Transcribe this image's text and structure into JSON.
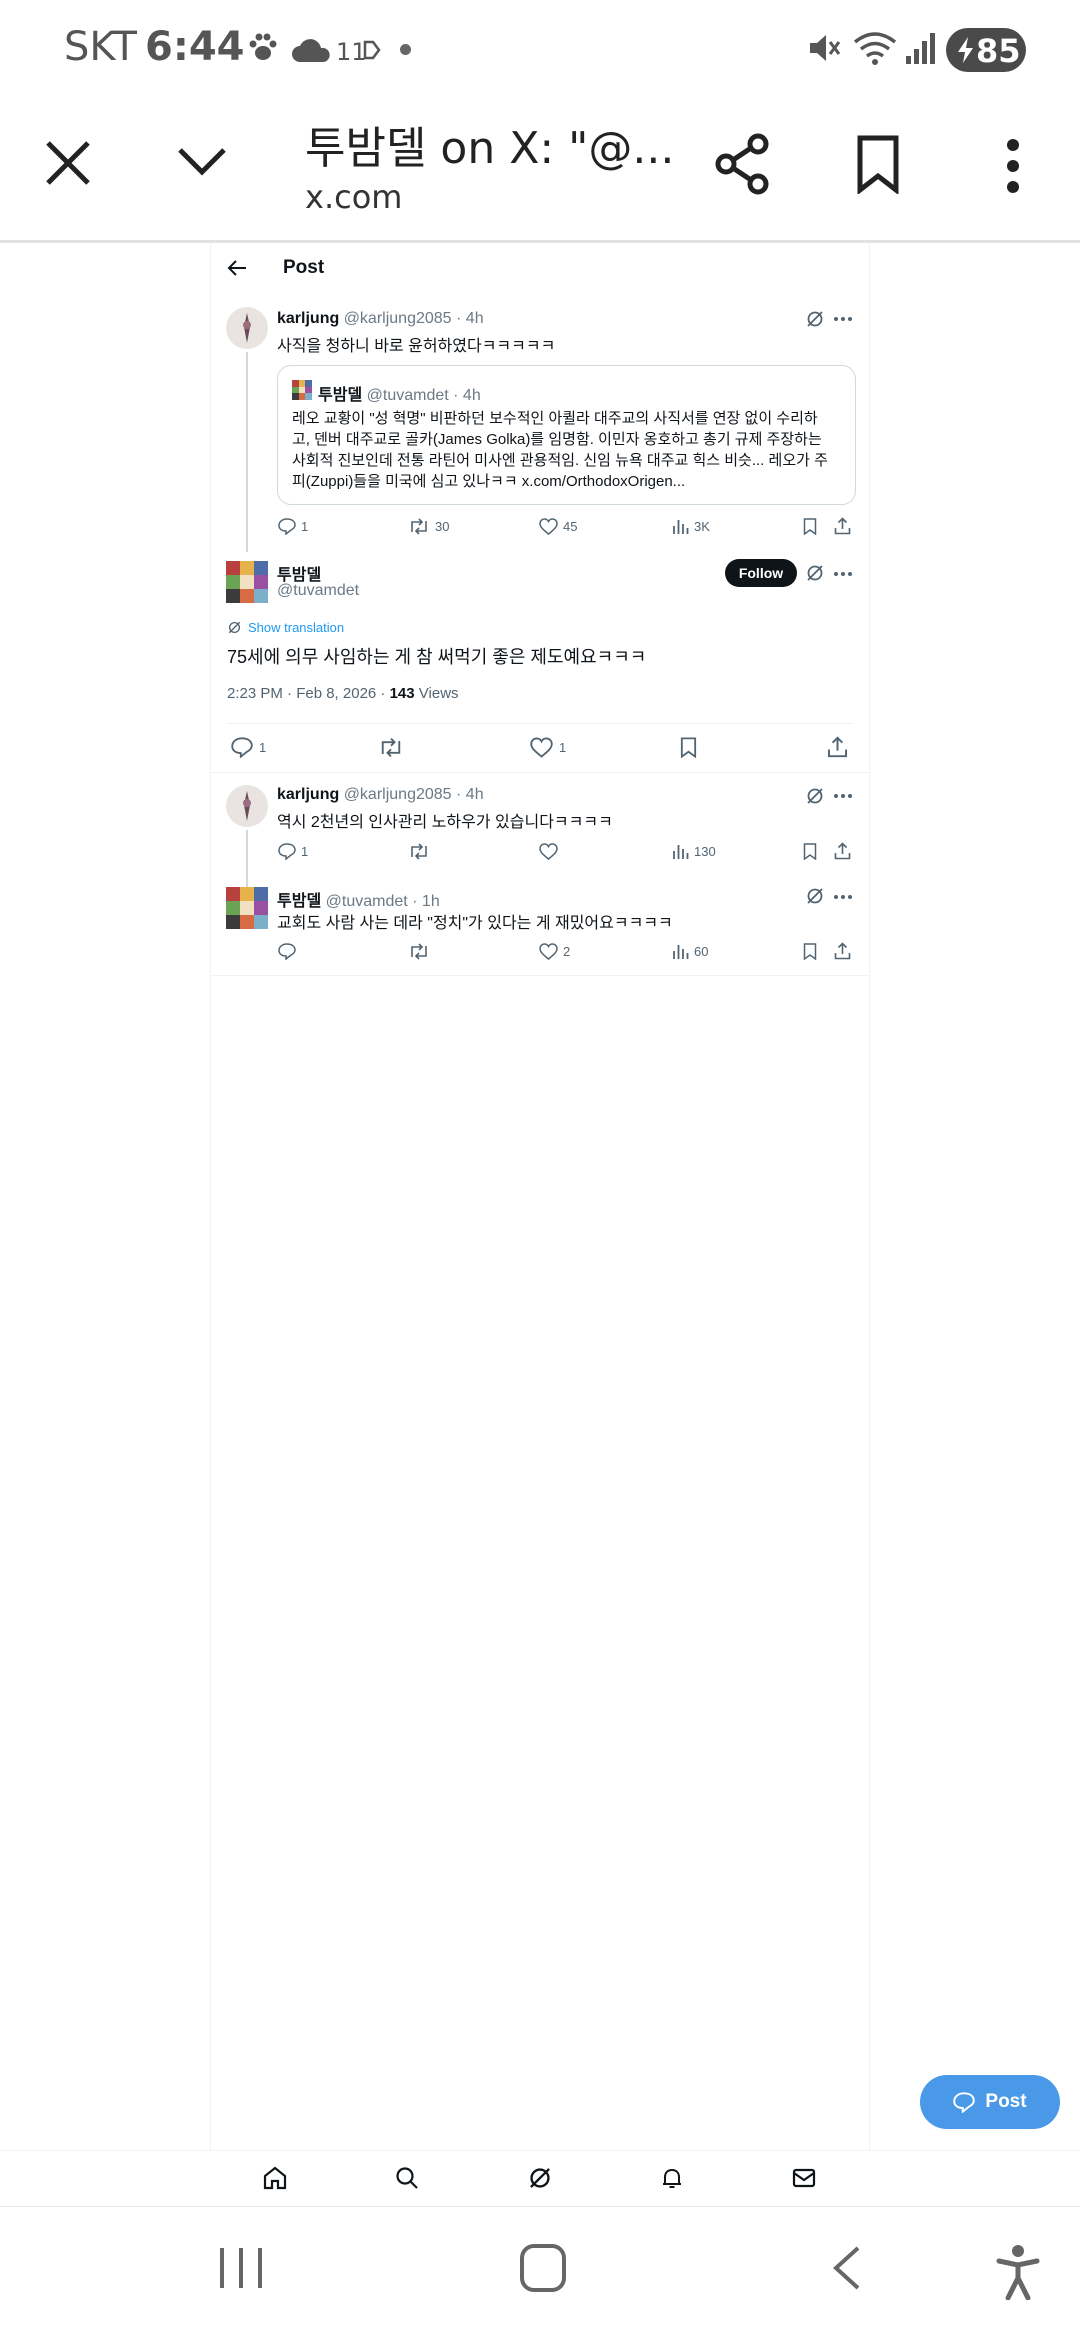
{
  "status_bar": {
    "carrier": "SKT",
    "time": "6:44",
    "temperature": "11",
    "battery": "85"
  },
  "browser_bar": {
    "title": "투밤델 on X: \"@...",
    "domain": "x.com"
  },
  "header": {
    "title": "Post"
  },
  "thread": [
    {
      "name": "karljung",
      "handle": "@karljung2085",
      "time": "· 4h",
      "text": "사직을 청하니 바로 윤허하였다ㅋㅋㅋㅋㅋ",
      "quote": {
        "name": "투밤델",
        "handle": "@tuvamdet",
        "time": "· 4h",
        "lines": [
          "레오 교황이 \"성 혁명\" 비판하던 보수적인 아퀼라 대주교의 사직서를 연장 없이 수리하",
          "고, 덴버 대주교로 골카(James Golka)를 임명함. 이민자 옹호하고 총기 규제 주장하는",
          "사회적 진보인데 전통 라틴어 미사엔 관용적임. 신임 뉴욕 대주교 힉스 비슷... 레오가 주",
          "피(Zuppi)들을 미국에 심고 있나ㅋㅋ x.com/OrthodoxOrigen..."
        ]
      },
      "stats": {
        "replies": "1",
        "reposts": "30",
        "likes": "45",
        "views": "3K"
      }
    }
  ],
  "main_post": {
    "name": "투밤델",
    "handle": "@tuvamdet",
    "follow_label": "Follow",
    "translate_label": "Show translation",
    "text": "75세에 의무 사임하는 게 참 써먹기 좋은 제도예요ㅋㅋㅋ",
    "timestamp": "2:23 PM · Feb 8, 2026 ·",
    "views_count": "143",
    "views_label": "Views",
    "stats": {
      "replies": "1",
      "likes": "1"
    }
  },
  "replies": [
    {
      "name": "karljung",
      "handle": "@karljung2085",
      "time": "· 4h",
      "text": "역시 2천년의 인사관리 노하우가 있습니다ㅋㅋㅋㅋ",
      "stats": {
        "replies": "1",
        "views": "130"
      }
    },
    {
      "name": "투밤델",
      "handle": "@tuvamdet",
      "time": "· 1h",
      "text": "교회도 사람 사는 데라 \"정치\"가 있다는 게 재밌어요ㅋㅋㅋㅋ",
      "stats": {
        "likes": "2",
        "views": "60"
      }
    }
  ],
  "fab": {
    "label": "Post"
  },
  "colors": {
    "accent": "#4a99e9",
    "text": "#0f1419",
    "muted": "#536471"
  }
}
